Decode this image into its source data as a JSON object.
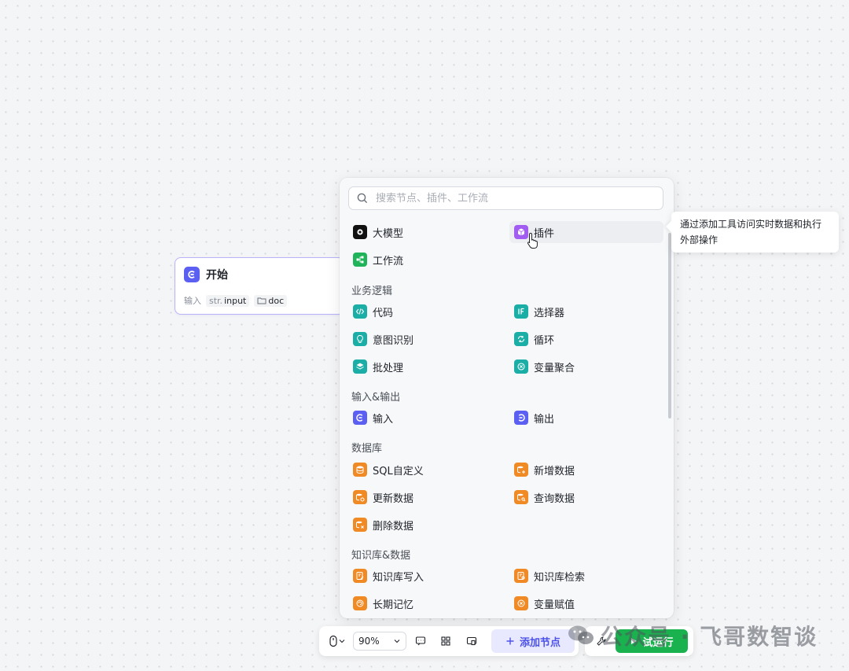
{
  "start_node": {
    "title": "开始",
    "io_label": "输入",
    "tags": [
      {
        "prefix": "str.",
        "name": "input"
      },
      {
        "name": "doc"
      }
    ]
  },
  "panel": {
    "search_placeholder": "搜索节点、插件、工作流",
    "top_items": [
      "大模型",
      "插件",
      "工作流"
    ],
    "sections": [
      {
        "title": "业务逻辑",
        "items": [
          "代码",
          "选择器",
          "意图识别",
          "循环",
          "批处理",
          "变量聚合"
        ]
      },
      {
        "title": "输入&输出",
        "items": [
          "输入",
          "输出"
        ]
      },
      {
        "title": "数据库",
        "items": [
          "SQL自定义",
          "新增数据",
          "更新数据",
          "查询数据",
          "删除数据"
        ]
      },
      {
        "title": "知识库&数据",
        "items": [
          "知识库写入",
          "知识库检索",
          "长期记忆",
          "变量赋值"
        ]
      }
    ]
  },
  "tooltip": {
    "line1": "通过添加工具访问实时数据和执行",
    "line2": "外部操作"
  },
  "toolbar": {
    "zoom": "90%",
    "add_node_label": "添加节点",
    "run_label": "试运行"
  },
  "watermark": "公众号 · 飞哥数智谈",
  "colors": {
    "accent": "#5b5ff2",
    "run_green": "#1ab14f",
    "logic_teal": "#1aaea6",
    "db_orange": "#f08a24",
    "plugin_purple": "#a25cf2"
  }
}
